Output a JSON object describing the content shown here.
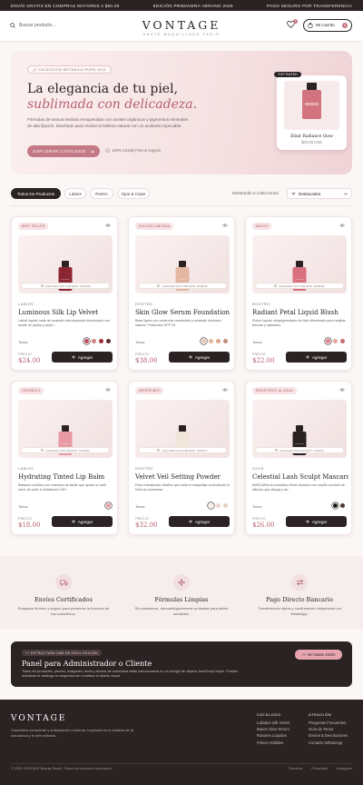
{
  "promo": {
    "left": "ENVÍO GRATIS EN COMPRAS MAYORES A $50.00",
    "center": "EDICIÓN PRIMAVERA-VERANO 2025",
    "right": "PAGO SEGURO POR TRANSFERENCIA"
  },
  "header": {
    "search_placeholder": "Buscar producto...",
    "brand": "VONTAGE",
    "tagline": "HAUTE MAQUILLAGE PARIS",
    "wishlist_count": "2",
    "cart_label": "Mi Carrito",
    "cart_count": "0"
  },
  "hero": {
    "badge": "COLECCIÓN BOTÁNICA PURE SILK",
    "title": "La elegancia de tu piel,",
    "subtitle": "sublimada con delicadeza.",
    "description": "Fórmulas de textura sedosa enriquecidas con aceites orgánicos y pigmentos minerales de alta fijación. Diseñado para realzar la belleza natural con un acabado impecable.",
    "cta": "EXPLORAR CATÁLOGO",
    "note": "100% Cruelty Free & Vegano",
    "featured_tag": "TOP RATED",
    "featured_name": "Elixir Radiance Glow",
    "featured_price": "$34.00 USD"
  },
  "filters": {
    "chips": [
      "Todos los Productos",
      "Labios",
      "Rostro",
      "Ojos & Cejas"
    ],
    "active": "Todos los Productos",
    "showing": "Mostrando 6 colecciones",
    "sort": "Destacados"
  },
  "product_common": {
    "tones_label": "Tonos:",
    "price_label": "PRECIO",
    "add_label": "Agregar",
    "bottle_label": "VONTAGE"
  },
  "products": [
    {
      "tag": "BEST SELLER",
      "expiry": "Caducidad: PAO 12M (EXP: 11/2026)",
      "category": "LABIOS",
      "name": "Luminous Silk Lip Velvet",
      "desc": "Labial líquido mate de acabado aterciopelado infusionado con aceite de jojoba y ácido...",
      "price": "$24.00",
      "bottle_color": "#8c2633",
      "swatches": [
        "#c24c5e",
        "#d27f86",
        "#a3303d",
        "#5c2a2c"
      ],
      "selected": 0
    },
    {
      "tag": "EDICIÓN LIMITADA",
      "expiry": "Caducidad: PAO 18M (EXP: 05/2026)",
      "category": "ROSTRO",
      "name": "Skin Glow Serum Foundation",
      "desc": "Base ligera con cobertura construible y acabado luminoso natural. Protección SPF 25.",
      "price": "$38.00",
      "bottle_color": "#e3b7a2",
      "swatches": [
        "#ecc6b4",
        "#e2b79d",
        "#d6a88d",
        "#c18f74"
      ],
      "selected": 0
    },
    {
      "tag": "NUEVO",
      "expiry": "Caducidad: PAO 12M (EXP: 09/2026)",
      "category": "ROSTRO",
      "name": "Radiant Petal Liquid Blush",
      "desc": "Rubor líquido ultrapigmentado de fácil difuminado para mejillas frescas y radiantes.",
      "price": "$22.00",
      "bottle_color": "#d9707f",
      "swatches": [
        "#de7c8b",
        "#e7a59a",
        "#c56b6e"
      ],
      "selected": 0
    },
    {
      "tag": "ORGÁNICO",
      "expiry": "Caducidad: PAO 6M (EXP: 10/2025)",
      "category": "LABIOS",
      "name": "Hydrating Tinted Lip Balm",
      "desc": "Bálsamo nutritivo con manteca de karité que aporta un sutil rubor de color e hidratación 24H.",
      "price": "$18.00",
      "bottle_color": "#e89aa2",
      "swatches": [
        "#ec9ea6"
      ],
      "selected": 0
    },
    {
      "tag": "IMPERDIBLE",
      "expiry": "Caducidad: PAO 24M (EXP: 02/2027)",
      "category": "ROSTRO",
      "name": "Velvet Veil Setting Powder",
      "desc": "Polvo translúcido ultrafino que sella el maquillaje controlando el brillo sin acartonar.",
      "price": "$32.00",
      "bottle_color": "#f1e6d8",
      "swatches": [
        "#f6ecdf",
        "#efd8cf",
        "#e7d0c0"
      ],
      "selected": 0
    },
    {
      "tag": "RESISTENTE AL AGUA",
      "expiry": "Caducidad: PAO 6M (EXP: 11/2025)",
      "category": "OJOS",
      "name": "Celestial Lash Sculpt Mascara",
      "desc": "MÁSCARA de pestañas efecto abanico con cepillo curvado de silicona que alarga y da...",
      "price": "$26.00",
      "bottle_color": "#2a2222",
      "swatches": [
        "#1f1a1a",
        "#4a3a34"
      ],
      "selected": 0
    }
  ],
  "features": [
    {
      "icon": "truck-icon",
      "title": "Envíos Certificados",
      "desc": "Empaque térmico y seguro para preservar la frescura de tus cosméticos."
    },
    {
      "icon": "sparkle-icon",
      "title": "Fórmulas Limpias",
      "desc": "Sin parabenos, dermatológicamente probadas para pieles sensibles."
    },
    {
      "icon": "transfer-icon",
      "title": "Pago Directo Bancario",
      "desc": "Transferencia rápida y confirmación instantánea vía WhatsApp."
    }
  ],
  "admin": {
    "badge": "ESTRUCTURA CMS DE FÁCIL EDICIÓN",
    "title": "Panel para Administrador o Cliente",
    "desc": "Todos los productos, precios, imágenes, tonos y fechas de caducidad están estructurados en un arreglo de objetos JavaScript limpio. Puedes actualizar el catálogo en segundos sin modificar el diseño visual.",
    "button": "Ver Datos JSON"
  },
  "footer": {
    "brand": "VONTAGE",
    "desc": "Cosmética consciente y sofisticación moderna. Inspirada en la sutileza de la naturaleza y el arte editorial.",
    "col1_title": "CATÁLOGO",
    "col1": [
      "Labiales Silk Velvet",
      "Bases Glow Serum",
      "Rubores Líquidos",
      "Polvos Volátiles"
    ],
    "col2_title": "ATENCIÓN",
    "col2": [
      "Preguntas Frecuentes",
      "Guía de Tonos",
      "Envíos & Devoluciones",
      "Contacto WhatsApp"
    ],
    "copyright": "© 2025 VONTAGE Beauty Studio. Todos los derechos reservados.",
    "links": [
      "Términos",
      "Privacidad",
      "Instagram"
    ]
  },
  "colors": {
    "accent": "#c47a86",
    "dark": "#2b2323",
    "price": "#b55f6d",
    "background": "#fbf7f6"
  }
}
